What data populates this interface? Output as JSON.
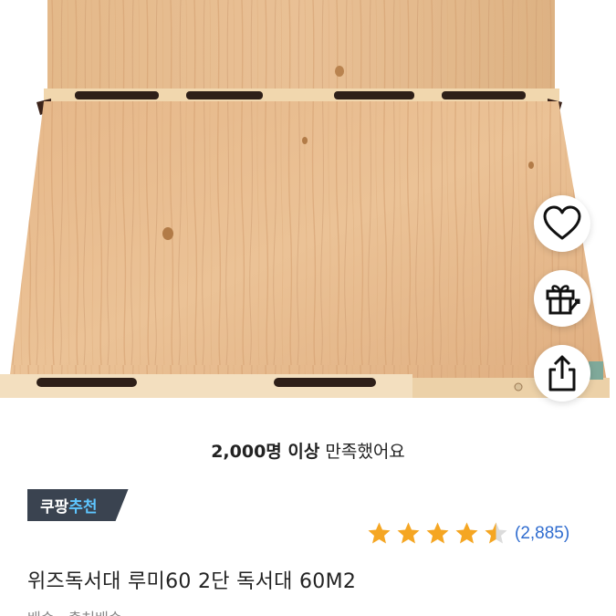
{
  "product": {
    "image_alt": "위즈독서대 루미60 2단 독서대 60M2 product photo"
  },
  "actions": {
    "like_icon": "heart-icon",
    "gift_icon": "gift-icon",
    "share_icon": "share-icon"
  },
  "satisfaction": {
    "count_text": "2,000명 이상",
    "suffix_text": " 만족했어요"
  },
  "badge": {
    "part1": "쿠팡",
    "part2": "추천"
  },
  "rating": {
    "stars": 4.5,
    "count_text": "(2,885)",
    "star_color": "#f5a623"
  },
  "title": "위즈독서대 루미60 2단 독서대 60M2",
  "subtext": "배송 · 출처배송"
}
